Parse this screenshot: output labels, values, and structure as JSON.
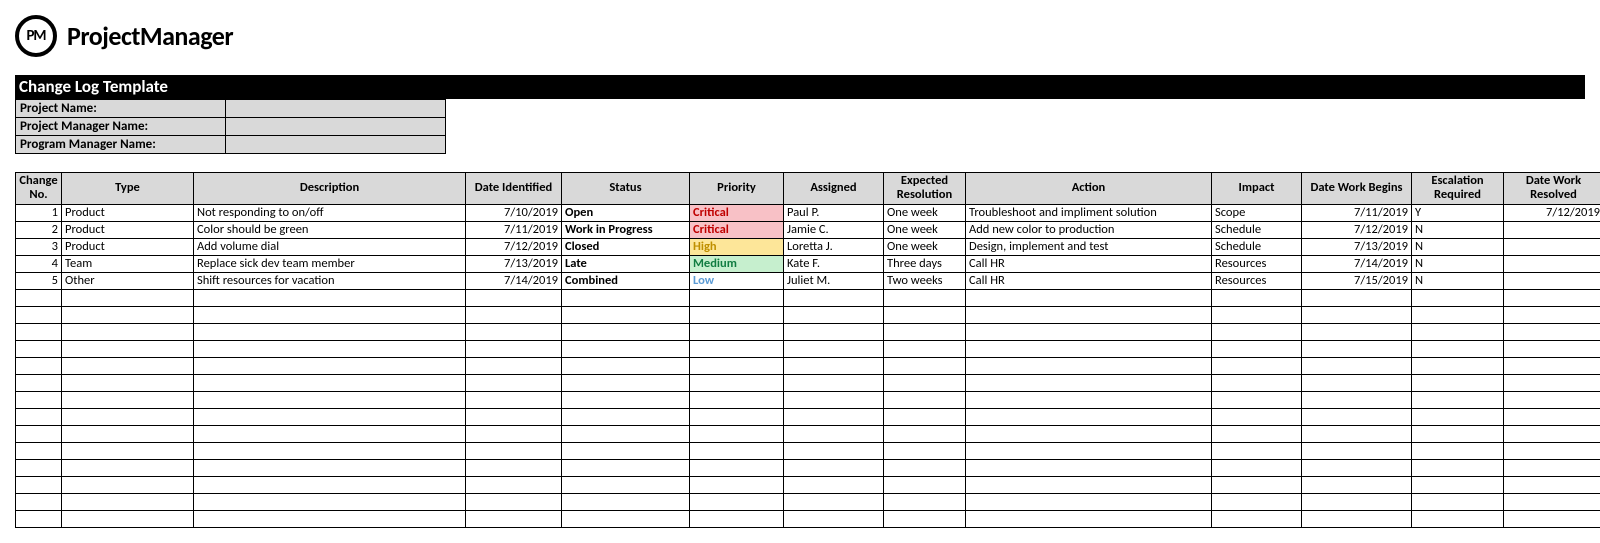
{
  "brand": {
    "badge": "PM",
    "name": "ProjectManager"
  },
  "title": "Change Log Template",
  "meta": {
    "labels": {
      "project": "Project Name:",
      "pm": "Project Manager Name:",
      "pgm": "Program Manager Name:"
    },
    "values": {
      "project": "",
      "pm": "",
      "pgm": ""
    }
  },
  "columns": [
    "Change No.",
    "Type",
    "Description",
    "Date Identified",
    "Status",
    "Priority",
    "Assigned",
    "Expected Resolution",
    "Action",
    "Impact",
    "Date Work Begins",
    "Escalation Required",
    "Date Work Resolved"
  ],
  "rows": [
    {
      "no": "1",
      "type": "Product",
      "desc": "Not responding to on/off",
      "date_id": "7/10/2019",
      "status": "Open",
      "priority": "Critical",
      "priority_class": "prio-critical",
      "assigned": "Paul P.",
      "expected": "One week",
      "action": "Troubleshoot and impliment solution",
      "impact": "Scope",
      "date_begins": "7/11/2019",
      "escalation": "Y",
      "date_resolved": "7/12/2019"
    },
    {
      "no": "2",
      "type": "Product",
      "desc": "Color should be green",
      "date_id": "7/11/2019",
      "status": "Work in Progress",
      "priority": "Critical",
      "priority_class": "prio-critical",
      "assigned": "Jamie C.",
      "expected": "One week",
      "action": "Add new color to production",
      "impact": "Schedule",
      "date_begins": "7/12/2019",
      "escalation": "N",
      "date_resolved": ""
    },
    {
      "no": "3",
      "type": "Product",
      "desc": "Add volume dial",
      "date_id": "7/12/2019",
      "status": "Closed",
      "priority": "High",
      "priority_class": "prio-high",
      "assigned": "Loretta J.",
      "expected": "One week",
      "action": "Design, implement and test",
      "impact": "Schedule",
      "date_begins": "7/13/2019",
      "escalation": "N",
      "date_resolved": ""
    },
    {
      "no": "4",
      "type": "Team",
      "desc": "Replace sick dev team member",
      "date_id": "7/13/2019",
      "status": "Late",
      "priority": "Medium",
      "priority_class": "prio-medium",
      "assigned": "Kate F.",
      "expected": "Three days",
      "action": "Call HR",
      "impact": "Resources",
      "date_begins": "7/14/2019",
      "escalation": "N",
      "date_resolved": ""
    },
    {
      "no": "5",
      "type": "Other",
      "desc": "Shift resources for vacation",
      "date_id": "7/14/2019",
      "status": "Combined",
      "priority": "Low",
      "priority_class": "prio-low",
      "assigned": "Juliet M.",
      "expected": "Two weeks",
      "action": "Call HR",
      "impact": "Resources",
      "date_begins": "7/15/2019",
      "escalation": "N",
      "date_resolved": ""
    }
  ],
  "empty_rows": 14
}
